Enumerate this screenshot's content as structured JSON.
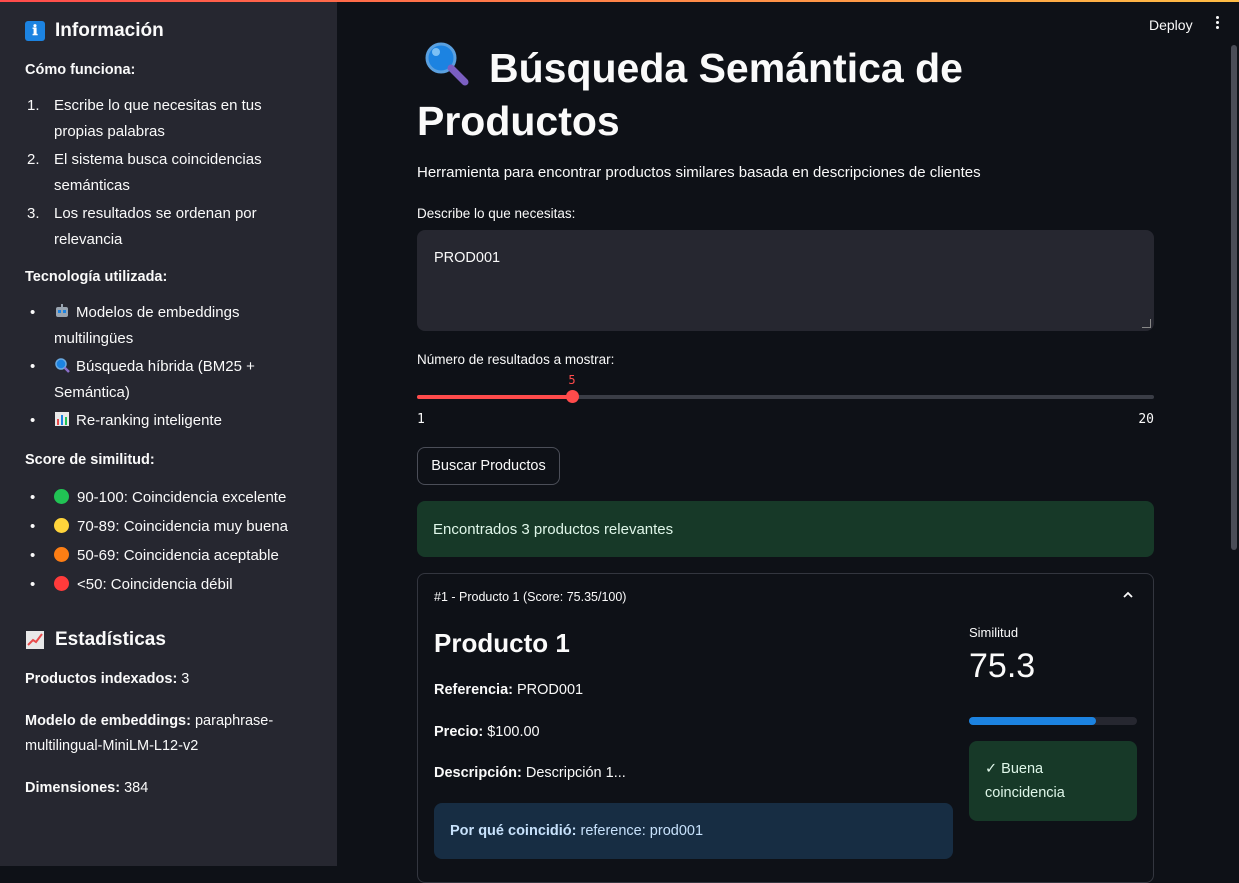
{
  "sidebar": {
    "info_title": "Información",
    "info_icon": "ℹ",
    "how_label": "Cómo funciona:",
    "how_steps": [
      {
        "num": "1.",
        "text": "Escribe lo que necesitas en tus propias palabras"
      },
      {
        "num": "2.",
        "text": "El sistema busca coincidencias semánticas"
      },
      {
        "num": "3.",
        "text": "Los resultados se ordenan por relevancia"
      }
    ],
    "tech_label": "Tecnología utilizada:",
    "tech_items": [
      {
        "icon": "robot-icon",
        "text": "Modelos de embeddings multilingües"
      },
      {
        "icon": "magnifier-icon",
        "text": "Búsqueda híbrida (BM25 + Semántica)"
      },
      {
        "icon": "bar-chart-icon",
        "text": "Re-ranking inteligente"
      }
    ],
    "score_label": "Score de similitud:",
    "score_items": [
      {
        "color": "#21c354",
        "text": "90-100: Coincidencia excelente"
      },
      {
        "color": "#ffd43b",
        "text": "70-89: Coincidencia muy buena"
      },
      {
        "color": "#fd7e14",
        "text": "50-69: Coincidencia aceptable"
      },
      {
        "color": "#ff3b3b",
        "text": "<50: Coincidencia débil"
      }
    ],
    "stats_title": "Estadísticas",
    "stats": {
      "indexed_label": "Productos indexados:",
      "indexed_value": " 3",
      "model_label": "Modelo de embeddings:",
      "model_value": " paraphrase-multilingual-MiniLM-L12-v2",
      "dims_label": "Dimensiones:",
      "dims_value": " 384"
    }
  },
  "header": {
    "deploy_label": "Deploy"
  },
  "main": {
    "title_icon": "magnifier-icon",
    "title": "Búsqueda Semántica de Productos",
    "subtitle": "Herramienta para encontrar productos similares basada en descripciones de clientes",
    "query_label": "Describe lo que necesitas:",
    "query_value": "PROD001",
    "slider_label": "Número de resultados a mostrar:",
    "slider": {
      "min": 1,
      "max": 20,
      "value": 5,
      "min_label": "1",
      "max_label": "20",
      "value_label": "5"
    },
    "search_button": "Buscar Productos",
    "success_msg": "Encontrados 3 productos relevantes",
    "result": {
      "header": "#1 - Producto 1 (Score: 75.35/100)",
      "name": "Producto 1",
      "ref_label": "Referencia:",
      "ref_value": " PROD001",
      "price_label": "Precio:",
      "price_value": " $100.00",
      "desc_label": "Descripción:",
      "desc_value": " Descripción 1...",
      "why_label": "Por qué coincidió:",
      "why_value": "reference: prod001",
      "similarity_label": "Similitud",
      "similarity_value": "75.3",
      "similarity_fraction": 0.753,
      "match_badge": "✓ Buena coincidencia"
    }
  },
  "colors": {
    "accent": "#ff4b4b",
    "progress": "#1c83e1",
    "success_bg": "#173928",
    "info_bg": "#172d43"
  }
}
